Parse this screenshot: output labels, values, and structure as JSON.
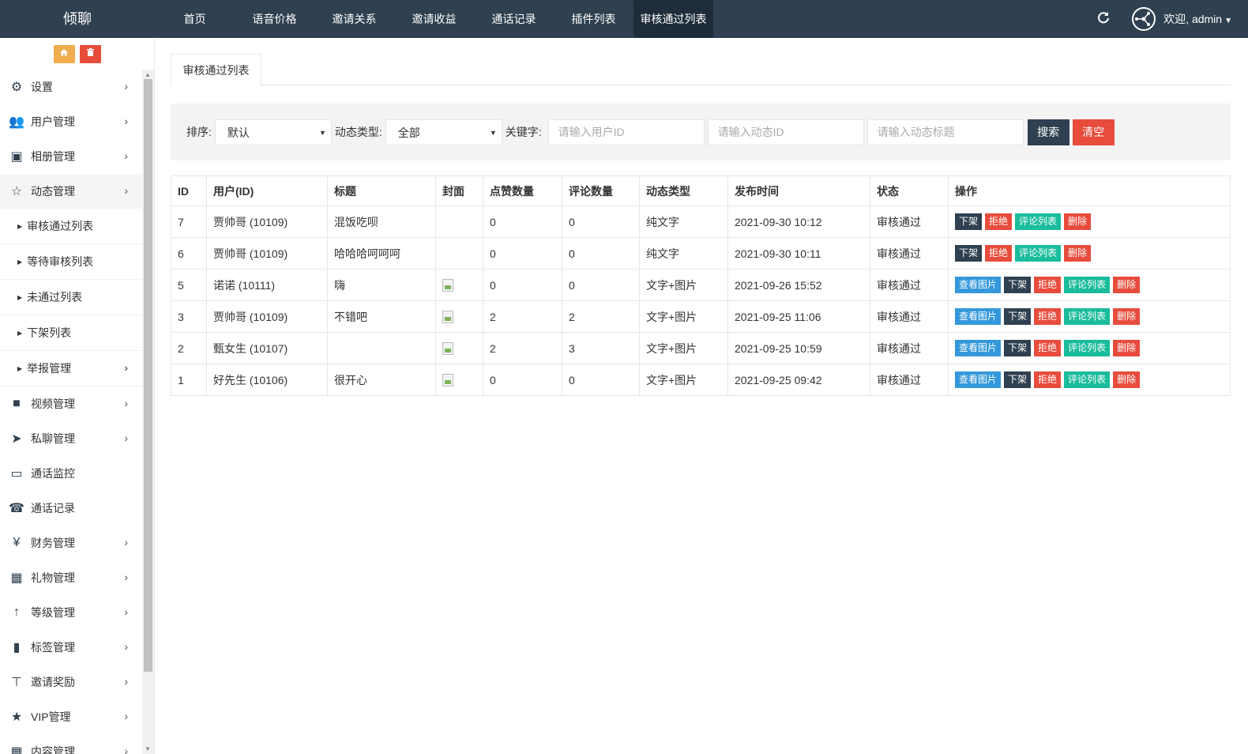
{
  "brand": "倾聊",
  "topnav": [
    {
      "label": "首页",
      "active": false
    },
    {
      "label": "语音价格",
      "active": false
    },
    {
      "label": "邀请关系",
      "active": false
    },
    {
      "label": "邀请收益",
      "active": false
    },
    {
      "label": "通话记录",
      "active": false
    },
    {
      "label": "插件列表",
      "active": false
    },
    {
      "label": "审核通过列表",
      "active": true
    }
  ],
  "user": {
    "welcome": "欢迎, admin"
  },
  "sidebar": {
    "items": [
      {
        "label": "设置",
        "icon": "gears-icon"
      },
      {
        "label": "用户管理",
        "icon": "users-icon"
      },
      {
        "label": "相册管理",
        "icon": "picture-icon"
      },
      {
        "label": "动态管理",
        "icon": "star-outline-icon"
      },
      {
        "label": "视频管理",
        "icon": "video-camera-icon"
      },
      {
        "label": "私聊管理",
        "icon": "paper-plane-icon"
      },
      {
        "label": "通话监控",
        "icon": "desktop-icon"
      },
      {
        "label": "通话记录",
        "icon": "phone-icon"
      },
      {
        "label": "财务管理",
        "icon": "yen-icon"
      },
      {
        "label": "礼物管理",
        "icon": "gift-icon"
      },
      {
        "label": "等级管理",
        "icon": "level-up-icon"
      },
      {
        "label": "标签管理",
        "icon": "bookmark-icon"
      },
      {
        "label": "邀请奖励",
        "icon": "sitemap-icon"
      },
      {
        "label": "VIP管理",
        "icon": "star-icon"
      },
      {
        "label": "内容管理",
        "icon": "grid-icon"
      }
    ],
    "sub_items": [
      {
        "label": "审核通过列表"
      },
      {
        "label": "等待审核列表"
      },
      {
        "label": "未通过列表"
      },
      {
        "label": "下架列表"
      },
      {
        "label": "举报管理"
      }
    ]
  },
  "tab": {
    "label": "审核通过列表"
  },
  "filters": {
    "sort_label": "排序:",
    "sort_value": "默认",
    "type_label": "动态类型:",
    "type_value": "全部",
    "keyword_label": "关键字:",
    "user_id_placeholder": "请输入用户ID",
    "dynamic_id_placeholder": "请输入动态ID",
    "title_placeholder": "请输入动态标题",
    "search_label": "搜索",
    "clear_label": "清空"
  },
  "table": {
    "headers": [
      "ID",
      "用户(ID)",
      "标题",
      "封面",
      "点赞数量",
      "评论数量",
      "动态类型",
      "发布时间",
      "状态",
      "操作"
    ],
    "rows": [
      {
        "id": "7",
        "user": "贾帅哥 (10109)",
        "title": "混饭吃呗",
        "has_cover": false,
        "likes": "0",
        "comments": "0",
        "type": "纯文字",
        "time": "2021-09-30 10:12",
        "status": "审核通过"
      },
      {
        "id": "6",
        "user": "贾帅哥 (10109)",
        "title": "哈哈哈呵呵呵",
        "has_cover": false,
        "likes": "0",
        "comments": "0",
        "type": "纯文字",
        "time": "2021-09-30 10:11",
        "status": "审核通过"
      },
      {
        "id": "5",
        "user": "诺诺 (10111)",
        "title": "嗨",
        "has_cover": true,
        "likes": "0",
        "comments": "0",
        "type": "文字+图片",
        "time": "2021-09-26 15:52",
        "status": "审核通过"
      },
      {
        "id": "3",
        "user": "贾帅哥 (10109)",
        "title": "不错吧",
        "has_cover": true,
        "likes": "2",
        "comments": "2",
        "type": "文字+图片",
        "time": "2021-09-25 11:06",
        "status": "审核通过"
      },
      {
        "id": "2",
        "user": "甄女生 (10107)",
        "title": "",
        "has_cover": true,
        "likes": "2",
        "comments": "3",
        "type": "文字+图片",
        "time": "2021-09-25 10:59",
        "status": "审核通过"
      },
      {
        "id": "1",
        "user": "好先生 (10106)",
        "title": "很开心",
        "has_cover": true,
        "likes": "0",
        "comments": "0",
        "type": "文字+图片",
        "time": "2021-09-25 09:42",
        "status": "审核通过"
      }
    ],
    "op_labels": {
      "view": "查看图片",
      "down": "下架",
      "reject": "拒绝",
      "comments": "评论列表",
      "delete": "删除"
    }
  },
  "colors": {
    "topbar": "#2f4050",
    "primary_dark": "#2f4050",
    "danger": "#e74c3c",
    "info": "#3498db",
    "success": "#1abc9c",
    "warning": "#f0ad4e"
  }
}
